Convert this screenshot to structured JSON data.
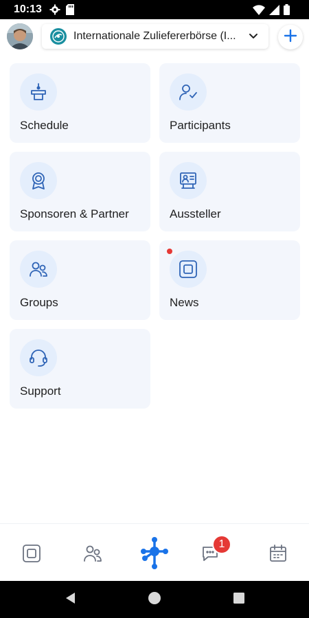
{
  "status_bar": {
    "time": "10:13"
  },
  "header": {
    "event_title": "Internationale Zuliefererbörse (I..."
  },
  "tiles": [
    {
      "label": "Schedule"
    },
    {
      "label": "Participants"
    },
    {
      "label": "Sponsoren & Partner"
    },
    {
      "label": "Aussteller"
    },
    {
      "label": "Groups"
    },
    {
      "label": "News"
    },
    {
      "label": "Support"
    }
  ],
  "bottom_nav": {
    "chat_badge": "1"
  },
  "colors": {
    "accent": "#1a73e8",
    "icon": "#2f64b6",
    "tile_bg": "#f3f6fc",
    "badge": "#e53935"
  }
}
